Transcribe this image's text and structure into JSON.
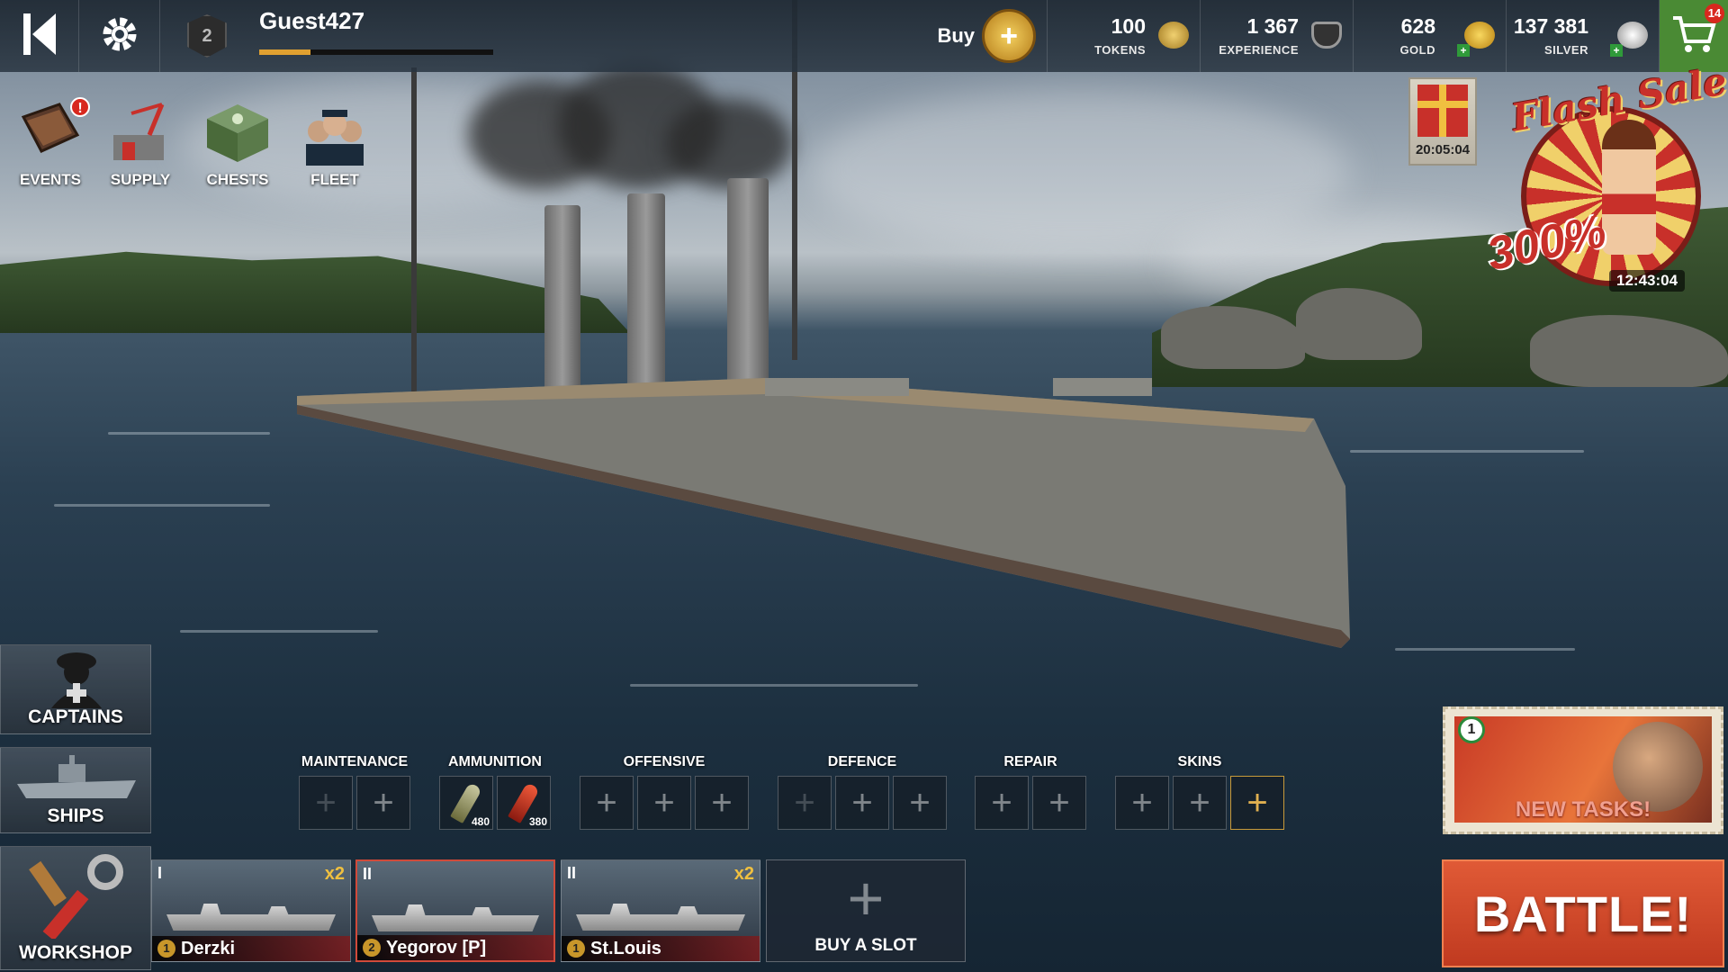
{
  "player": {
    "name": "Guest427",
    "rank": "2",
    "xp_fraction": 0.22
  },
  "topbar": {
    "back_icon": "back-arrow-icon",
    "settings_icon": "gear-icon",
    "buy_label": "Buy",
    "currencies": [
      {
        "value": "100",
        "label": "TOKENS",
        "icon": "token-coin-icon",
        "color": "#d8b040"
      },
      {
        "value": "1 367",
        "label": "EXPERIENCE",
        "icon": "experience-shield-icon",
        "color": "#444444"
      },
      {
        "value": "628",
        "label": "GOLD",
        "icon": "gold-coins-icon",
        "color": "#e0b030"
      },
      {
        "value": "137 381",
        "label": "SILVER",
        "icon": "silver-coins-icon",
        "color": "#c8c8c8"
      }
    ],
    "cart_badge": "14"
  },
  "menu": [
    {
      "label": "EVENTS",
      "icon": "events-book-icon",
      "alert": "!"
    },
    {
      "label": "SUPPLY",
      "icon": "supply-crane-icon"
    },
    {
      "label": "CHESTS",
      "icon": "chest-icon"
    },
    {
      "label": "FLEET",
      "icon": "fleet-officers-icon"
    }
  ],
  "gift": {
    "timer": "20:05:04"
  },
  "flash_sale": {
    "title": "Flash Sale",
    "percent": "300%",
    "timer": "12:43:04"
  },
  "side": {
    "captains": "CAPTAINS",
    "ships": "SHIPS",
    "workshop": "WORKSHOP"
  },
  "slots": {
    "maintenance": "MAINTENANCE",
    "ammunition": "AMMUNITION",
    "ammo_counts": [
      "480",
      "380"
    ],
    "offensive": "OFFENSIVE",
    "defence": "DEFENCE",
    "repair": "REPAIR",
    "skins": "SKINS"
  },
  "ships": [
    {
      "tier": "I",
      "mult": "x2",
      "level": "1",
      "name": "Derzki"
    },
    {
      "tier": "II",
      "mult": "",
      "level": "2",
      "name": "Yegorov [P]"
    },
    {
      "tier": "II",
      "mult": "x2",
      "level": "1",
      "name": "St.Louis"
    }
  ],
  "buy_slot": "BUY A SLOT",
  "tasks": {
    "badge": "1",
    "label": "NEW TASKS!"
  },
  "battle": "BATTLE!",
  "colors": {
    "battle": "#d04a2c",
    "cart": "#4a8a34",
    "accent_gold": "#e0a030"
  }
}
